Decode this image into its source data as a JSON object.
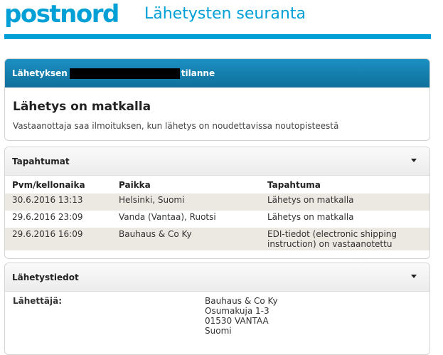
{
  "header": {
    "logo": "postnord",
    "title": "Lähetysten seuranta"
  },
  "status": {
    "label_prefix": "Lähetyksen",
    "label_suffix": "tilanne",
    "headline": "Lähetys on matkalla",
    "description": "Vastaanottaja saa ilmoituksen, kun lähetys on noudettavissa noutopisteestä"
  },
  "events": {
    "section_title": "Tapahtumat",
    "columns": [
      "Pvm/kellonaika",
      "Paikka",
      "Tapahtuma"
    ],
    "rows": [
      [
        "30.6.2016 13:13",
        "Helsinki, Suomi",
        "Lähetys on matkalla"
      ],
      [
        "29.6.2016 23:09",
        "Vanda (Vantaa), Ruotsi",
        "Lähetys on matkalla"
      ],
      [
        "29.6.2016 16:09",
        "Bauhaus & Co Ky",
        "EDI-tiedot (electronic shipping instruction) on vastaanotettu"
      ]
    ]
  },
  "details": {
    "section_title": "Lähetystiedot",
    "sender_label": "Lähettäjä:",
    "sender_lines": [
      "Bauhaus & Co Ky",
      "Osumakuja 1-3",
      "01530 VANTAA",
      "Suomi"
    ]
  }
}
